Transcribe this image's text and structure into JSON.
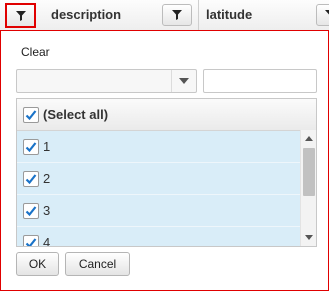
{
  "header": {
    "columns": [
      {
        "label": "description"
      },
      {
        "label": "latitude"
      }
    ]
  },
  "filter_popup": {
    "clear_label": "Clear",
    "operator_value": "",
    "value_input": "",
    "select_all": {
      "label": "(Select all)",
      "checked": true
    },
    "items": [
      {
        "label": "1",
        "checked": true
      },
      {
        "label": "2",
        "checked": true
      },
      {
        "label": "3",
        "checked": true
      },
      {
        "label": "4",
        "checked": true
      }
    ],
    "ok_label": "OK",
    "cancel_label": "Cancel"
  },
  "colors": {
    "active_border": "#e00000",
    "checkmark": "#1a73c8",
    "item_bg": "#d9edf8"
  }
}
